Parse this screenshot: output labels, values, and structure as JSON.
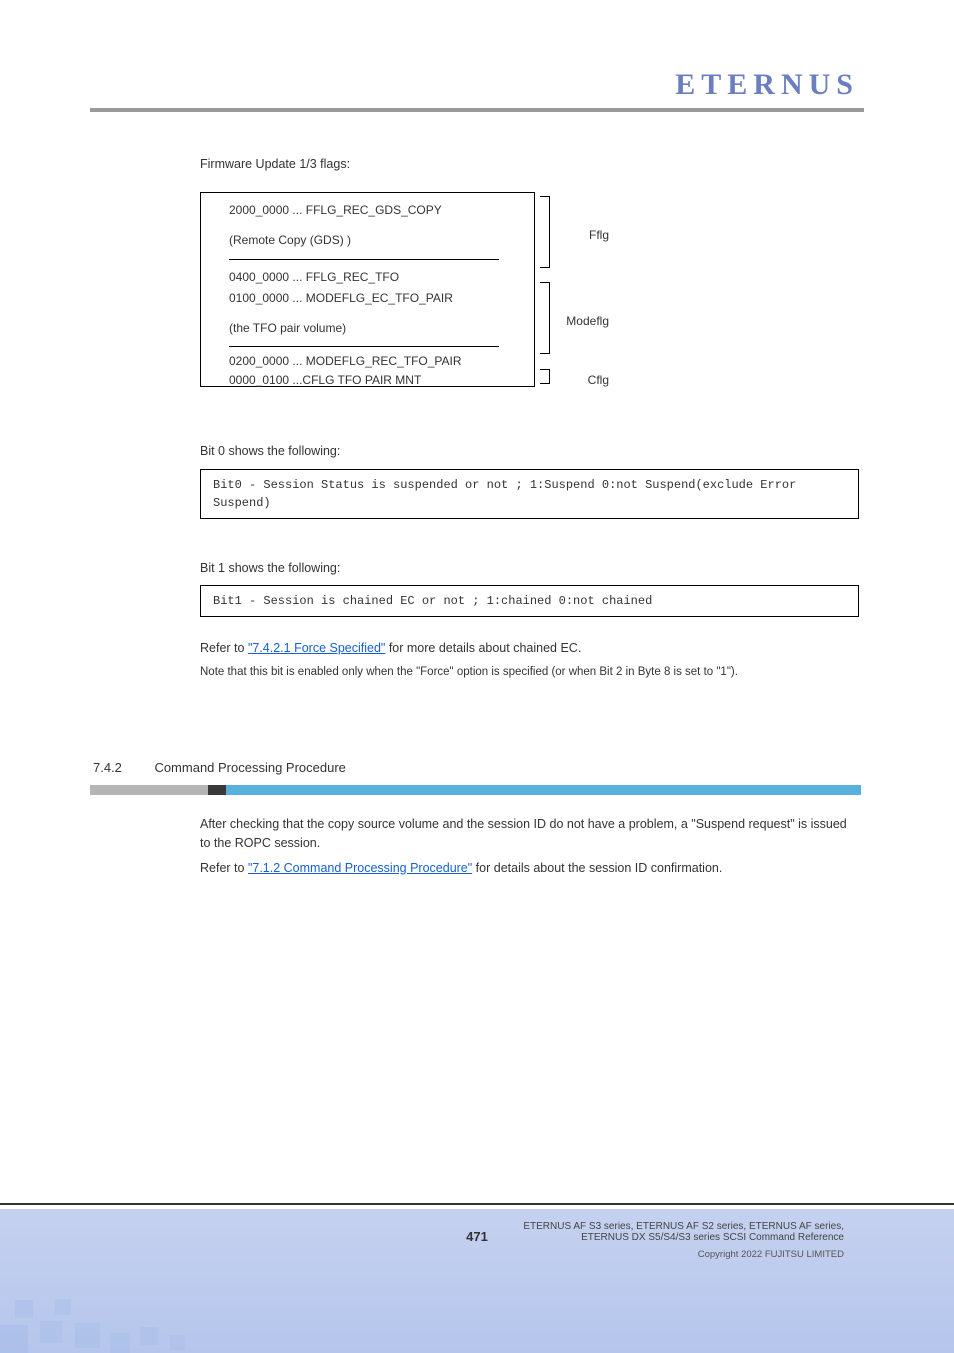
{
  "brand": "ETERNUS",
  "flags_title": "Firmware Update 1/3 flags:",
  "flags": {
    "entry1": "2000_0000 ... FFLG_REC_GDS_COPY",
    "entry2": "(Remote Copy (GDS) )",
    "entry3": "0400_0000 ... FFLG_REC_TFO",
    "entry4": "0100_0000 ... MODEFLG_EC_TFO_PAIR",
    "entry5": "(the TFO pair volume)",
    "entry6": "0200_0000 ... MODEFLG_REC_TFO_PAIR",
    "entry7": "0000_0100 ...CFLG TFO PAIR MNT",
    "bracket1": "Fflg",
    "bracket2": "Modeflg",
    "bracket3": "Cflg"
  },
  "bit0_label": "Bit 0 shows the following:",
  "bit0_code": "Bit0 - Session Status is suspended or not ; 1:Suspend 0:not Suspend(exclude Error Suspend)",
  "bit1_label": "Bit 1 shows the following:",
  "bit1_code": "Bit1 - Session is chained EC or not      ; 1:chained 0:not chained",
  "bit1_explain_prefix": "Refer to ",
  "bit1_explain_link": "\"7.4.2.1 Force Specified\"",
  "bit1_explain_suffix": " for more details about chained EC.",
  "bit1_note": "Note that this bit is enabled only when the \"Force\" option is specified (or when Bit 2 in Byte 8 is set to \"1\").",
  "section_number": "7.4.2",
  "section_title": "Command Processing Procedure",
  "section_body": {
    "p1": "After checking that the copy source volume and the session ID do not have a problem, a \"Suspend request\" is issued to the ROPC session.",
    "p2_prefix": "Refer to ",
    "p2_link": "\"7.1.2 Command Processing Procedure\"",
    "p2_suffix": " for details about the session ID confirmation."
  },
  "footer": {
    "page": "471",
    "product_line1": "ETERNUS AF S3 series, ETERNUS AF S2 series, ETERNUS AF series,",
    "product_line2": "ETERNUS DX S5/S4/S3 series SCSI Command Reference",
    "copyright": "Copyright 2022 FUJITSU LIMITED"
  }
}
